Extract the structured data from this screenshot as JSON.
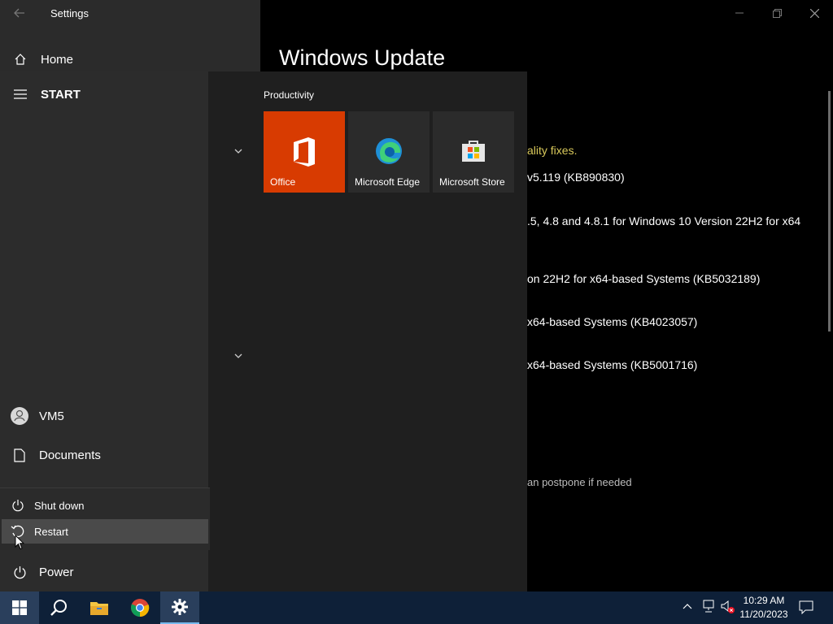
{
  "settings": {
    "title": "Settings",
    "home_label": "Home",
    "page_title": "Windows Update",
    "update_lines": [
      "ality fixes.",
      "v5.119 (KB890830)",
      ".5, 4.8 and 4.8.1 for Windows 10 Version 22H2 for x64",
      "on 22H2 for x64-based Systems (KB5032189)",
      " x64-based Systems (KB4023057)",
      " x64-based Systems (KB5001716)",
      "an postpone if needed"
    ],
    "accent_text_color": "#d9c95b"
  },
  "start": {
    "header": "START",
    "group_title": "Productivity",
    "tiles": [
      {
        "label": "Office",
        "icon": "office-icon",
        "color": "#d83b01"
      },
      {
        "label": "Microsoft Edge",
        "icon": "edge-icon",
        "color": "#2b2b2b"
      },
      {
        "label": "Microsoft Store",
        "icon": "store-icon",
        "color": "#2b2b2b"
      }
    ],
    "user": "VM5",
    "documents": "Documents",
    "power": "Power",
    "power_menu": {
      "shutdown": "Shut down",
      "restart": "Restart"
    }
  },
  "taskbar": {
    "time": "10:29 AM",
    "date": "11/20/2023",
    "color": "#0e2038"
  }
}
